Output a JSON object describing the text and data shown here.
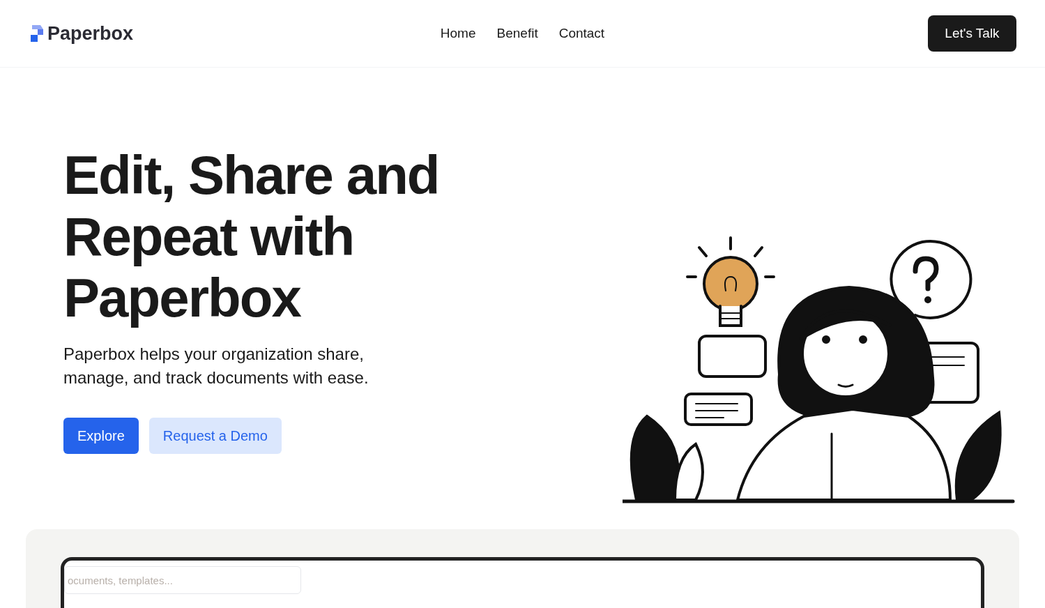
{
  "header": {
    "logo": "Paperbox",
    "nav": [
      "Home",
      "Benefit",
      "Contact"
    ],
    "cta": "Let's Talk"
  },
  "hero": {
    "title": "Edit, Share and Repeat with Paperbox",
    "subtitle": "Paperbox helps your organization share, manage, and track documents with ease.",
    "buttons": [
      {
        "label": "Explore",
        "kind": "primary"
      },
      {
        "label": "Request a Demo",
        "kind": "secondary"
      }
    ]
  },
  "preview": {
    "search": {
      "placeholder": "ocuments, templates..."
    }
  }
}
